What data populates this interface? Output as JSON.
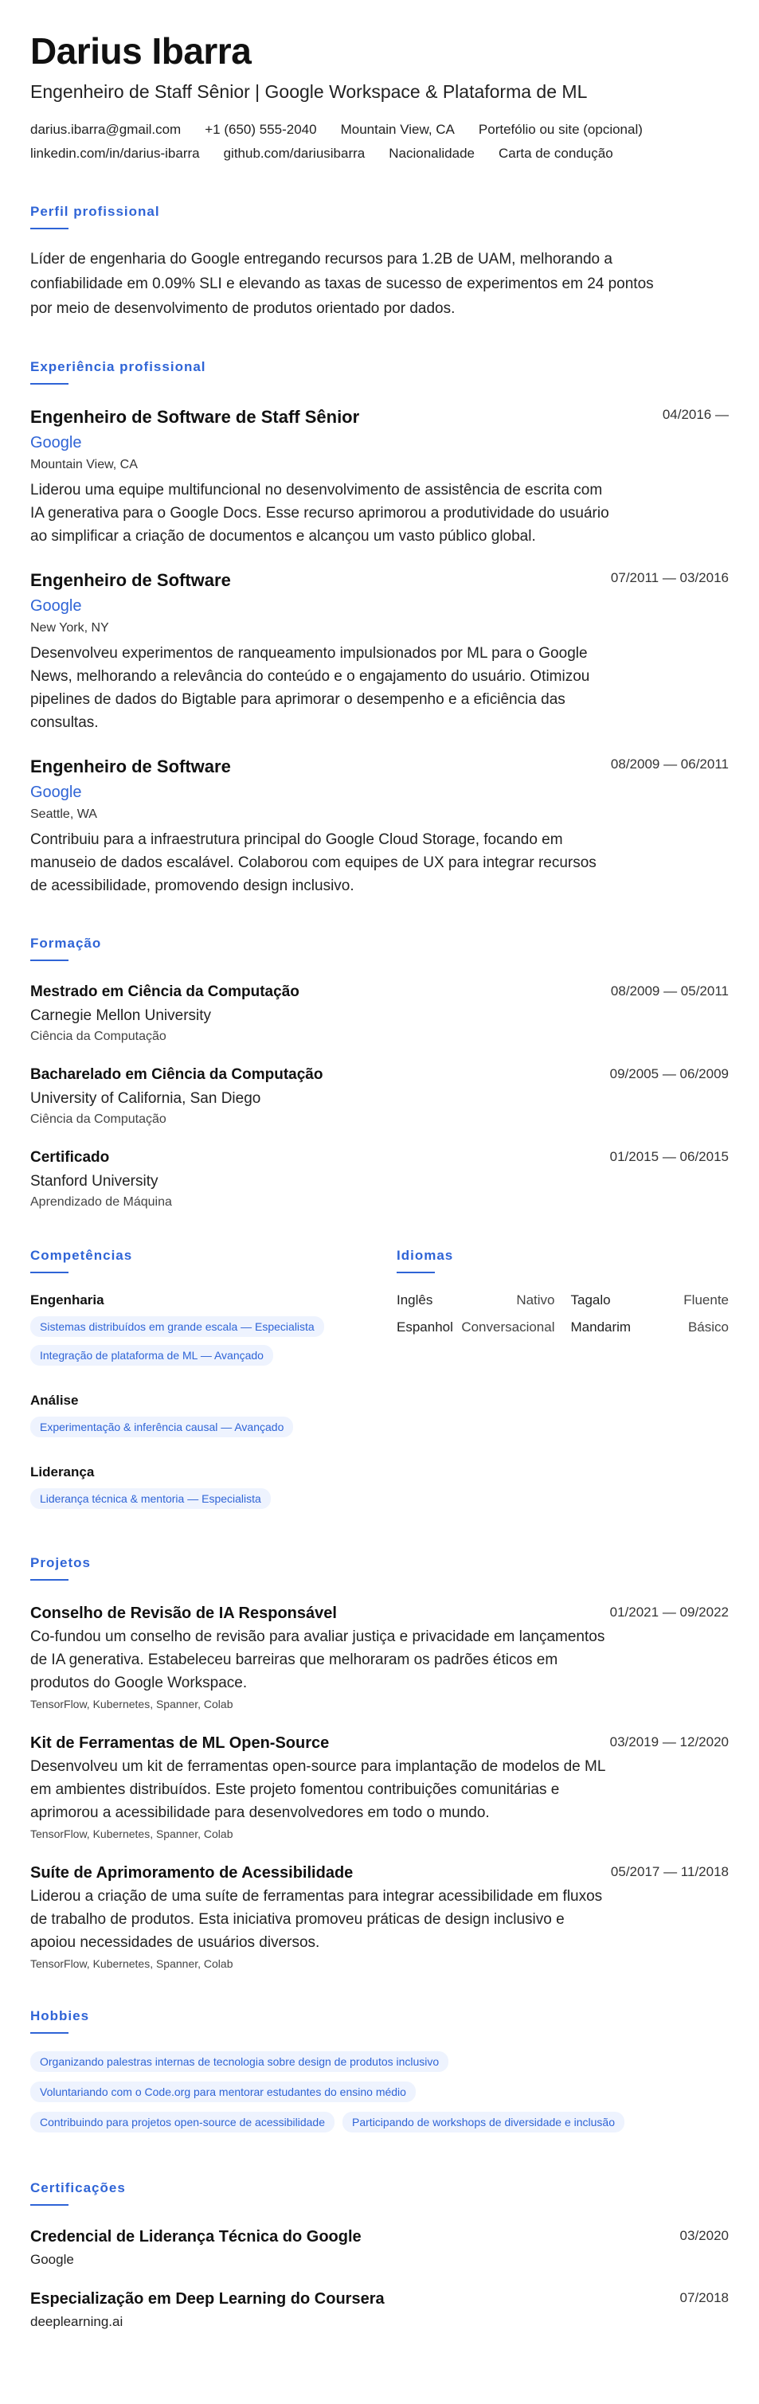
{
  "header": {
    "name": "Darius Ibarra",
    "headline": "Engenheiro de Staff Sênior | Google Workspace & Plataforma de ML",
    "contact": [
      "darius.ibarra@gmail.com",
      "+1 (650) 555-2040",
      "Mountain View, CA",
      "Portefólio ou site (opcional)",
      "linkedin.com/in/darius-ibarra",
      "github.com/dariusibarra",
      "Nacionalidade",
      "Carta de condução"
    ]
  },
  "summary": {
    "title": "Perfil profissional",
    "text": "Líder de engenharia do Google entregando recursos para 1.2B de UAM, melhorando a confiabilidade em 0.09% SLI e elevando as taxas de sucesso de experimentos em 24 pontos por meio de desenvolvimento de produtos orientado por dados."
  },
  "experience": {
    "title": "Experiência profissional",
    "items": [
      {
        "role": "Engenheiro de Software de Staff Sênior",
        "company": "Google",
        "location": "Mountain View, CA",
        "dates": "04/2016 —",
        "description": "Liderou uma equipe multifuncional no desenvolvimento de assistência de escrita com IA generativa para o Google Docs. Esse recurso aprimorou a produtividade do usuário ao simplificar a criação de documentos e alcançou um vasto público global."
      },
      {
        "role": "Engenheiro de Software",
        "company": "Google",
        "location": "New York, NY",
        "dates": "07/2011 — 03/2016",
        "description": "Desenvolveu experimentos de ranqueamento impulsionados por ML para o Google News, melhorando a relevância do conteúdo e o engajamento do usuário. Otimizou pipelines de dados do Bigtable para aprimorar o desempenho e a eficiência das consultas."
      },
      {
        "role": "Engenheiro de Software",
        "company": "Google",
        "location": "Seattle, WA",
        "dates": "08/2009 — 06/2011",
        "description": "Contribuiu para a infraestrutura principal do Google Cloud Storage, focando em manuseio de dados escalável. Colaborou com equipes de UX para integrar recursos de acessibilidade, promovendo design inclusivo."
      }
    ]
  },
  "education": {
    "title": "Formação",
    "items": [
      {
        "degree": "Mestrado em Ciência da Computação",
        "school": "Carnegie Mellon University",
        "field": "Ciência da Computação",
        "dates": "08/2009 — 05/2011"
      },
      {
        "degree": "Bacharelado em Ciência da Computação",
        "school": "University of California, San Diego",
        "field": "Ciência da Computação",
        "dates": "09/2005 — 06/2009"
      },
      {
        "degree": "Certificado",
        "school": "Stanford University",
        "field": "Aprendizado de Máquina",
        "dates": "01/2015 — 06/2015"
      }
    ]
  },
  "skills": {
    "title": "Competências",
    "categories": [
      {
        "name": "Engenharia",
        "tags": [
          "Sistemas distribuídos em grande escala — Especialista",
          "Integração de plataforma de ML — Avançado"
        ]
      },
      {
        "name": "Análise",
        "tags": [
          "Experimentação & inferência causal — Avançado"
        ]
      },
      {
        "name": "Liderança",
        "tags": [
          "Liderança técnica & mentoria — Especialista"
        ]
      }
    ]
  },
  "languages": {
    "title": "Idiomas",
    "items": [
      {
        "name": "Inglês",
        "level": "Nativo"
      },
      {
        "name": "Tagalo",
        "level": "Fluente"
      },
      {
        "name": "Espanhol",
        "level": "Conversacional"
      },
      {
        "name": "Mandarim",
        "level": "Básico"
      }
    ]
  },
  "projects": {
    "title": "Projetos",
    "items": [
      {
        "name": "Conselho de Revisão de IA Responsável",
        "dates": "01/2021 — 09/2022",
        "description": "Co-fundou um conselho de revisão para avaliar justiça e privacidade em lançamentos de IA generativa. Estabeleceu barreiras que melhoraram os padrões éticos em produtos do Google Workspace.",
        "tech": "TensorFlow, Kubernetes, Spanner, Colab"
      },
      {
        "name": "Kit de Ferramentas de ML Open-Source",
        "dates": "03/2019 — 12/2020",
        "description": "Desenvolveu um kit de ferramentas open-source para implantação de modelos de ML em ambientes distribuídos. Este projeto fomentou contribuições comunitárias e aprimorou a acessibilidade para desenvolvedores em todo o mundo.",
        "tech": "TensorFlow, Kubernetes, Spanner, Colab"
      },
      {
        "name": "Suíte de Aprimoramento de Acessibilidade",
        "dates": "05/2017 — 11/2018",
        "description": "Liderou a criação de uma suíte de ferramentas para integrar acessibilidade em fluxos de trabalho de produtos. Esta iniciativa promoveu práticas de design inclusivo e apoiou necessidades de usuários diversos.",
        "tech": "TensorFlow, Kubernetes, Spanner, Colab"
      }
    ]
  },
  "hobbies": {
    "title": "Hobbies",
    "items": [
      "Organizando palestras internas de tecnologia sobre design de produtos inclusivo",
      "Voluntariando com o Code.org para mentorar estudantes do ensino médio",
      "Contribuindo para projetos open-source de acessibilidade",
      "Participando de workshops de diversidade e inclusão"
    ]
  },
  "certifications": {
    "title": "Certificações",
    "items": [
      {
        "name": "Credencial de Liderança Técnica do Google",
        "issuer": "Google",
        "date": "03/2020"
      },
      {
        "name": "Especialização em Deep Learning do Coursera",
        "issuer": "deeplearning.ai",
        "date": "07/2018"
      }
    ]
  },
  "colors": {
    "accent": "#2f64d6",
    "tag_background": "#eef3fe",
    "text": "#1f2328"
  }
}
